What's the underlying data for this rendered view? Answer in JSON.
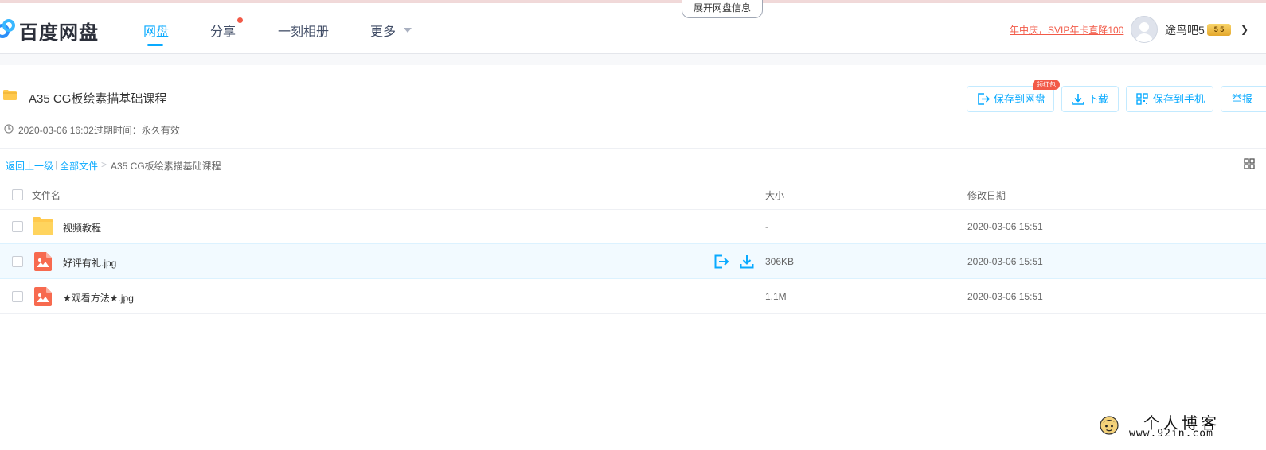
{
  "header": {
    "logo_text": "百度网盘",
    "nav": [
      {
        "label": "网盘",
        "active": true
      },
      {
        "label": "分享",
        "has_dot": true
      },
      {
        "label": "一刻相册"
      },
      {
        "label": "更多",
        "has_dropdown": true
      }
    ],
    "expand_label": "展开网盘信息",
    "promo": "年中庆，SVIP年卡直降100",
    "username": "途鸟吧5",
    "vip_badge": "5 5"
  },
  "share": {
    "title": "A35 CG板绘素描基础课程",
    "meta": "2020-03-06 16:02过期时间：永久有效",
    "actions": {
      "save_to_disk": "保存到网盘",
      "redpack_tag": "领红包",
      "download": "下载",
      "save_to_phone": "保存到手机",
      "report": "举报"
    }
  },
  "breadcrumb": {
    "back": "返回上一级",
    "sep1": "|",
    "all_files": "全部文件",
    "sep2": ">",
    "current": "A35 CG板绘素描基础课程"
  },
  "table": {
    "headers": {
      "name": "文件名",
      "size": "大小",
      "date": "修改日期"
    },
    "rows": [
      {
        "type": "folder",
        "name": "视频教程",
        "size": "-",
        "date": "2020-03-06 15:51"
      },
      {
        "type": "image",
        "name": "好评有礼.jpg",
        "size": "306KB",
        "date": "2020-03-06 15:51"
      },
      {
        "type": "image",
        "name": "★观看方法★.jpg",
        "size": "1.1M",
        "date": "2020-03-06 15:51"
      }
    ]
  },
  "watermark": {
    "title": "个人博客",
    "url": "www.92in.com"
  },
  "colors": {
    "accent": "#09aaff",
    "promo": "#f25a48",
    "folder": "#ffc94d",
    "image_icon": "#f76a4f"
  }
}
